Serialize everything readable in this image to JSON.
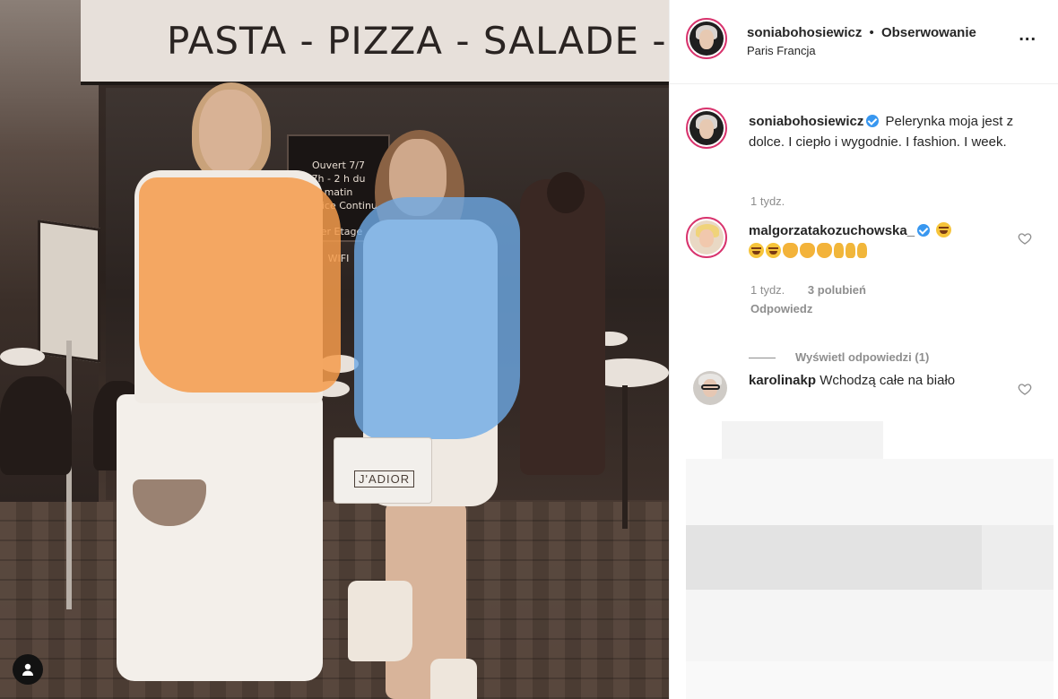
{
  "photo": {
    "awning_text": "PASTA - PIZZA - SALADE - AN",
    "window_text": "Ouvert 7/7\n7h - 2 h du matin\nService Continu\n\n1er Etage\n\nWIFI",
    "bag_label": "J'ADIOR",
    "tag_icon": "user-tag-icon"
  },
  "post": {
    "header": {
      "username": "soniabohosiewicz",
      "dot": "•",
      "follow_label": "Obserwowanie",
      "location": "Paris Francja",
      "more_label": "..."
    },
    "caption": {
      "username": "soniabohosiewicz",
      "text": "Pelerynka moja jest z dolce. I ciepło i wygodnie. I fashion. I week.",
      "time": "1 tydz."
    },
    "comments": [
      {
        "username": "malgorzatakozuchowska_",
        "verified": true,
        "time": "1 tydz.",
        "likes": "3 polubień",
        "reply_label": "Odpowiedz",
        "view_replies_label": "Wyświetl odpowiedzi (1)"
      },
      {
        "username": "karolinakp",
        "text": "Wchodzą całe na biało"
      }
    ]
  },
  "colors": {
    "verified": "#3897f0",
    "story_ring": "#d8336d",
    "muted_text": "#8e8e8e"
  }
}
